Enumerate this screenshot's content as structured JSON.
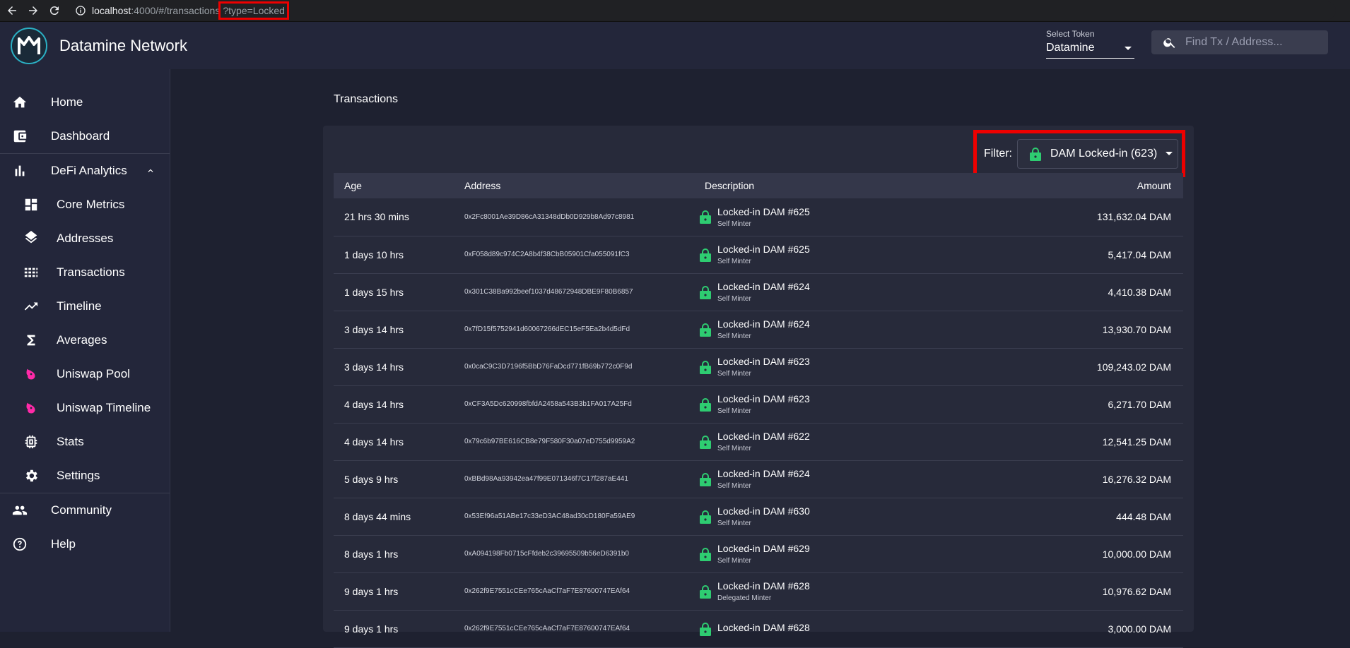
{
  "browser": {
    "url_host": "localhost",
    "url_path": ":4000/#/transactions",
    "url_query": "?type=Locked"
  },
  "header": {
    "logo_text": "M",
    "title": "Datamine Network",
    "token_label": "Select Token",
    "token_value": "Datamine",
    "search_placeholder": "Find Tx / Address..."
  },
  "sidebar": {
    "items": [
      {
        "label": "Home",
        "icon": "home-icon"
      },
      {
        "label": "Dashboard",
        "icon": "wallet-icon"
      },
      {
        "label": "DeFi Analytics",
        "icon": "bar-chart-icon"
      },
      {
        "label": "Core Metrics",
        "icon": "dashboard-icon"
      },
      {
        "label": "Addresses",
        "icon": "layers-icon"
      },
      {
        "label": "Transactions",
        "icon": "grid-icon"
      },
      {
        "label": "Timeline",
        "icon": "trending-up-icon"
      },
      {
        "label": "Averages",
        "icon": "sigma-icon"
      },
      {
        "label": "Uniswap Pool",
        "icon": "unicorn-icon"
      },
      {
        "label": "Uniswap Timeline",
        "icon": "unicorn-icon"
      },
      {
        "label": "Stats",
        "icon": "chip-icon"
      },
      {
        "label": "Settings",
        "icon": "gear-icon"
      },
      {
        "label": "Community",
        "icon": "people-icon"
      },
      {
        "label": "Help",
        "icon": "help-icon"
      }
    ]
  },
  "main": {
    "title": "Transactions",
    "filter_label": "Filter:",
    "filter_value": "DAM Locked-in (623)",
    "columns": [
      "Age",
      "Address",
      "Description",
      "Amount"
    ],
    "rows": [
      {
        "age": "21 hrs 30 mins",
        "address": "0x2Fc8001Ae39D86cA31348dDb0D929b8Ad97c8981",
        "title": "Locked-in DAM #625",
        "sub": "Self Minter",
        "amount": "131,632.04 DAM"
      },
      {
        "age": "1 days 10 hrs",
        "address": "0xF058d89c974C2A8b4f38CbB05901Cfa055091fC3",
        "title": "Locked-in DAM #625",
        "sub": "Self Minter",
        "amount": "5,417.04 DAM"
      },
      {
        "age": "1 days 15 hrs",
        "address": "0x301C38Ba992beef1037d48672948DBE9F80B6857",
        "title": "Locked-in DAM #624",
        "sub": "Self Minter",
        "amount": "4,410.38 DAM"
      },
      {
        "age": "3 days 14 hrs",
        "address": "0x7fD15f5752941d60067266dEC15eF5Ea2b4d5dFd",
        "title": "Locked-in DAM #624",
        "sub": "Self Minter",
        "amount": "13,930.70 DAM"
      },
      {
        "age": "3 days 14 hrs",
        "address": "0x0caC9C3D7196f5BbD76FaDcd771fB69b772c0F9d",
        "title": "Locked-in DAM #623",
        "sub": "Self Minter",
        "amount": "109,243.02 DAM"
      },
      {
        "age": "4 days 14 hrs",
        "address": "0xCF3A5Dc620998fbfdA2458a543B3b1FA017A25Fd",
        "title": "Locked-in DAM #623",
        "sub": "Self Minter",
        "amount": "6,271.70 DAM"
      },
      {
        "age": "4 days 14 hrs",
        "address": "0x79c6b97BE616CB8e79F580F30a07eD755d9959A2",
        "title": "Locked-in DAM #622",
        "sub": "Self Minter",
        "amount": "12,541.25 DAM"
      },
      {
        "age": "5 days 9 hrs",
        "address": "0xBBd98Aa93942ea47f99E071346f7C17f287aE441",
        "title": "Locked-in DAM #624",
        "sub": "Self Minter",
        "amount": "16,276.32 DAM"
      },
      {
        "age": "8 days 44 mins",
        "address": "0x53Ef96a51ABe17c33eD3AC48ad30cD180Fa59AE9",
        "title": "Locked-in DAM #630",
        "sub": "Self Minter",
        "amount": "444.48 DAM"
      },
      {
        "age": "8 days 1 hrs",
        "address": "0xA094198Fb0715cFfdeb2c39695509b56eD6391b0",
        "title": "Locked-in DAM #629",
        "sub": "Self Minter",
        "amount": "10,000.00 DAM"
      },
      {
        "age": "9 days 1 hrs",
        "address": "0x262f9E7551cCEe765cAaCf7aF7E87600747EAf64",
        "title": "Locked-in DAM #628",
        "sub": "Delegated Minter",
        "amount": "10,976.62 DAM"
      },
      {
        "age": "9 days 1 hrs",
        "address": "0x262f9E7551cCEe765cAaCf7aF7E87600747EAf64",
        "title": "Locked-in DAM #628",
        "sub": "",
        "amount": "3,000.00 DAM"
      }
    ]
  },
  "colors": {
    "accent_lock": "#2ecc71",
    "highlight": "#ee0000"
  }
}
